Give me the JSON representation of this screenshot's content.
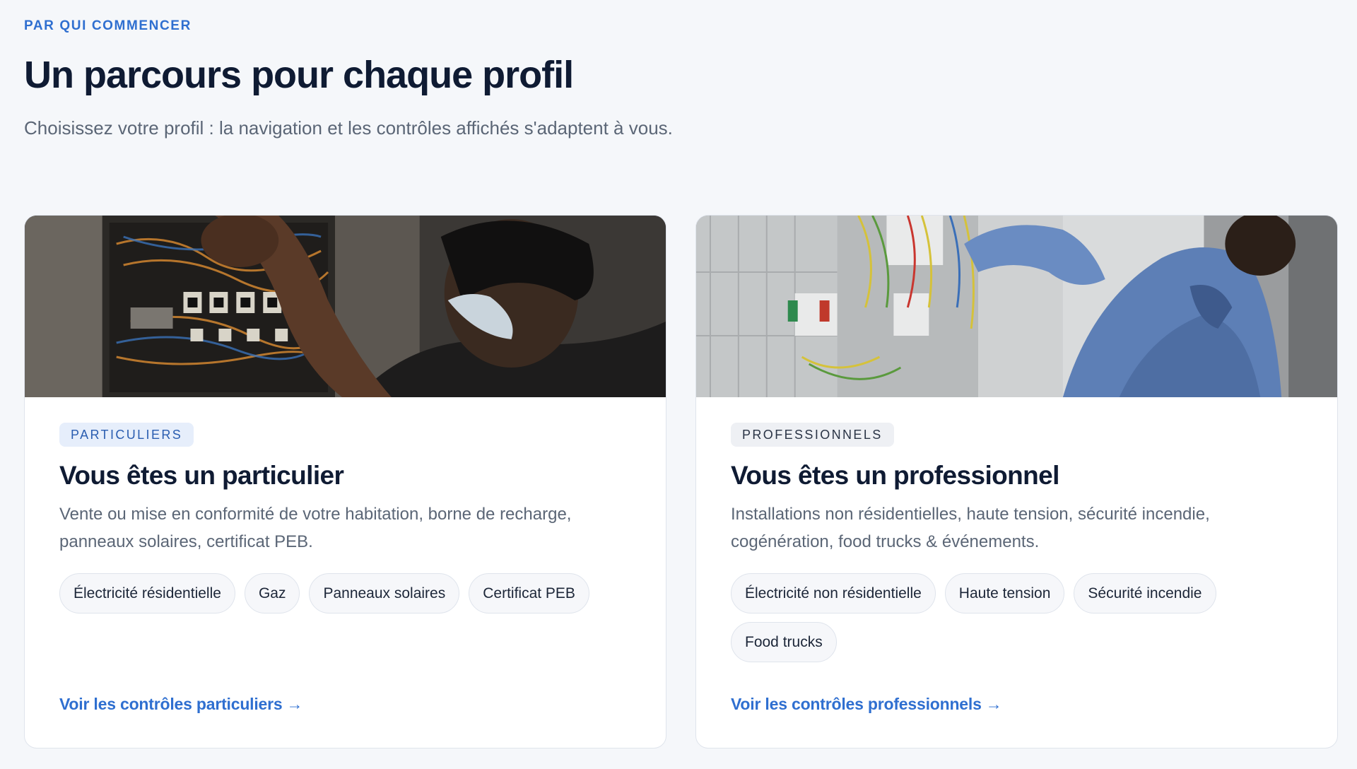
{
  "header": {
    "eyebrow": "PAR QUI COMMENCER",
    "title": "Un parcours pour chaque profil",
    "subtitle": "Choisissez votre profil : la navigation et les contrôles affichés s'adaptent à vous."
  },
  "cards": [
    {
      "badge": "PARTICULIERS",
      "title": "Vous êtes un particulier",
      "description": "Vente ou mise en conformité de votre habitation, borne de recharge, panneaux solaires, certificat PEB.",
      "tags": [
        "Électricité résidentielle",
        "Gaz",
        "Panneaux solaires",
        "Certificat PEB"
      ],
      "link": "Voir les contrôles particuliers",
      "arrow": "→",
      "image_alt": "Technicien masqué travaillant sur un tableau électrique"
    },
    {
      "badge": "PROFESSIONNELS",
      "title": "Vous êtes un professionnel",
      "description": "Installations non résidentielles, haute tension, sécurité incendie, cogénération, food trucks & événements.",
      "tags": [
        "Électricité non résidentielle",
        "Haute tension",
        "Sécurité incendie",
        "Food trucks"
      ],
      "link": "Voir les contrôles professionnels",
      "arrow": "→",
      "image_alt": "Technicien en chemise bleue câblant une armoire électrique"
    }
  ],
  "colors": {
    "accent": "#2f6fd0",
    "heading": "#0f1b33",
    "muted": "#5b6676",
    "background": "#f5f7fa"
  }
}
